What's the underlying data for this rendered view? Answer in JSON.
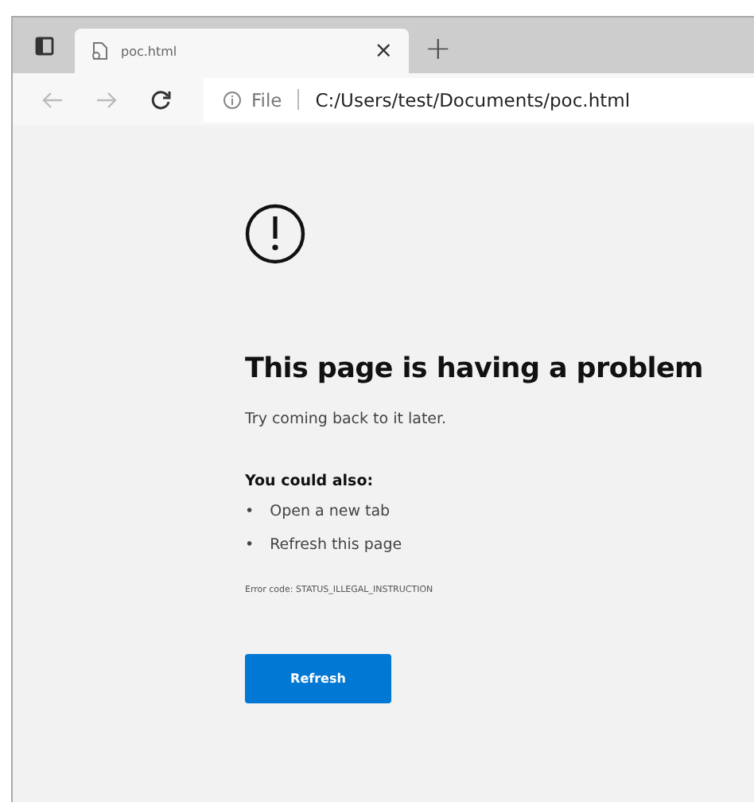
{
  "browser": {
    "tabs": [
      {
        "title": "poc.html",
        "selected": true
      }
    ],
    "new_tab": "+",
    "close": "×",
    "address": {
      "scheme": "File",
      "url": "C:/Users/test/Documents/poc.html"
    }
  },
  "error_page": {
    "title": "This page is having a problem",
    "message": "Try coming back to it later.",
    "suggestions_heading": "You could also:",
    "suggestions": [
      {
        "bullet": "•",
        "text": "Open a new tab"
      },
      {
        "bullet": "•",
        "text": "Refresh this page"
      }
    ],
    "error_code": "Error code: STATUS_ILLEGAL_INSTRUCTION",
    "button": "Refresh"
  }
}
